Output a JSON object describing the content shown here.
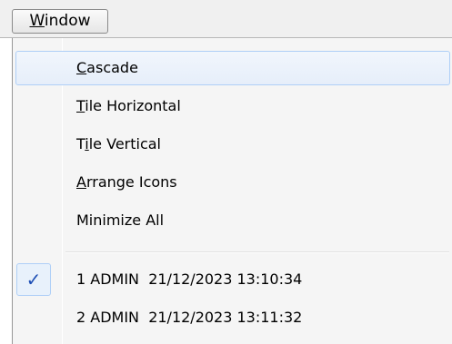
{
  "menu": {
    "title_mnemonic": "W",
    "title_rest": "indow"
  },
  "items": [
    {
      "mnemonic": "C",
      "rest": "ascade",
      "prefix": ""
    },
    {
      "mnemonic": "T",
      "rest": "ile Horizontal",
      "prefix": ""
    },
    {
      "prefix": "T",
      "mnemonic": "i",
      "rest": "le Vertical"
    },
    {
      "mnemonic": "A",
      "rest": "rrange Icons",
      "prefix": ""
    },
    {
      "prefix": "",
      "mnemonic": "",
      "rest": "Minimize All"
    }
  ],
  "windows": [
    {
      "label": "1 ADMIN  21/12/2023 13:10:34",
      "checked": true,
      "check_glyph": "✓"
    },
    {
      "label": "2 ADMIN  21/12/2023 13:11:32",
      "checked": false
    }
  ]
}
